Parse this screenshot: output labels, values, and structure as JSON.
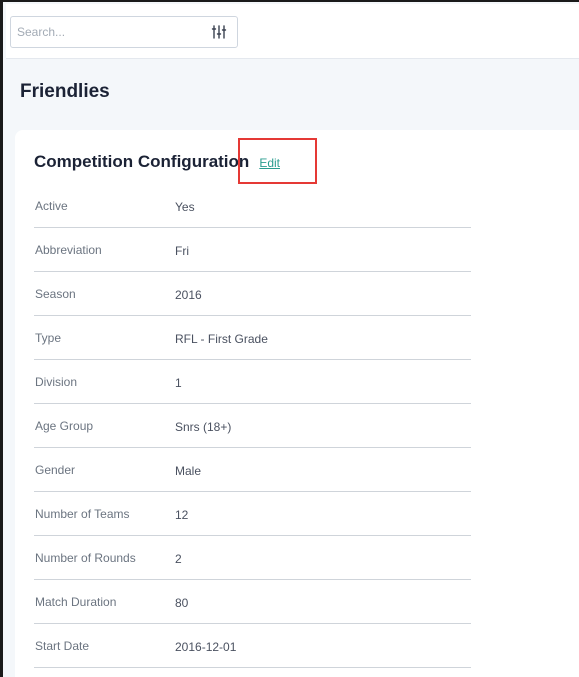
{
  "search": {
    "placeholder": "Search..."
  },
  "page": {
    "title": "Friendlies"
  },
  "card": {
    "title": "Competition Configuration",
    "edit_label": "Edit",
    "rows": [
      {
        "label": "Active",
        "value": "Yes"
      },
      {
        "label": "Abbreviation",
        "value": "Fri"
      },
      {
        "label": "Season",
        "value": "2016"
      },
      {
        "label": "Type",
        "value": "RFL - First Grade"
      },
      {
        "label": "Division",
        "value": "1"
      },
      {
        "label": "Age Group",
        "value": "Snrs (18+)"
      },
      {
        "label": "Gender",
        "value": "Male"
      },
      {
        "label": "Number of Teams",
        "value": "12"
      },
      {
        "label": "Number of Rounds",
        "value": "2"
      },
      {
        "label": "Match Duration",
        "value": "80"
      },
      {
        "label": "Start Date",
        "value": "2016-12-01"
      }
    ]
  },
  "icons": {
    "filter": "sliders-filter-icon"
  },
  "colors": {
    "accent": "#2a9d8f",
    "highlight": "#e53935",
    "title": "#1b2235"
  }
}
